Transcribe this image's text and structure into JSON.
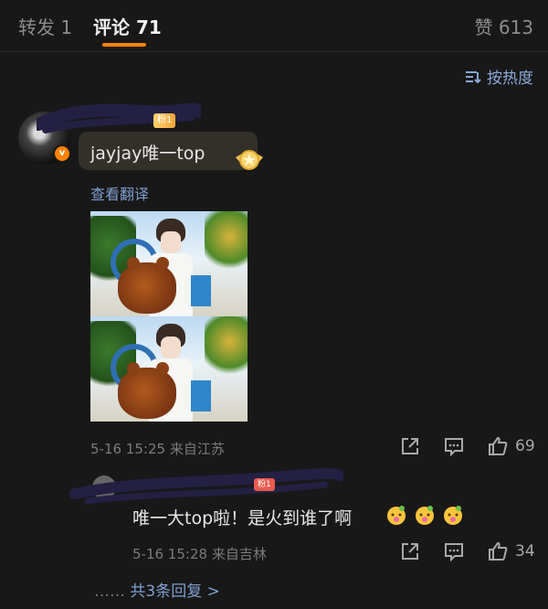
{
  "tabs": {
    "repost_label": "转发 1",
    "comment_label": "评论 71",
    "like_label": "赞 613"
  },
  "sort": {
    "label": "按热度"
  },
  "comment": {
    "fan_badge": "粉1",
    "text": "jayjay唯一top",
    "translate": "查看翻译",
    "time": "5-16 15:25",
    "location": "来自江苏",
    "like_count": "69",
    "verified_mark": "v"
  },
  "reply": {
    "fan_badge": "粉1",
    "text": "唯一大top啦！是火到谁了啊",
    "time": "5-16 15:28",
    "location": "来自吉林",
    "like_count": "34"
  },
  "more_replies": {
    "dots": "……",
    "link": "共3条回复 >"
  },
  "colors": {
    "accent": "#ff8200",
    "link": "#7f9fcf",
    "background": "#181818"
  }
}
